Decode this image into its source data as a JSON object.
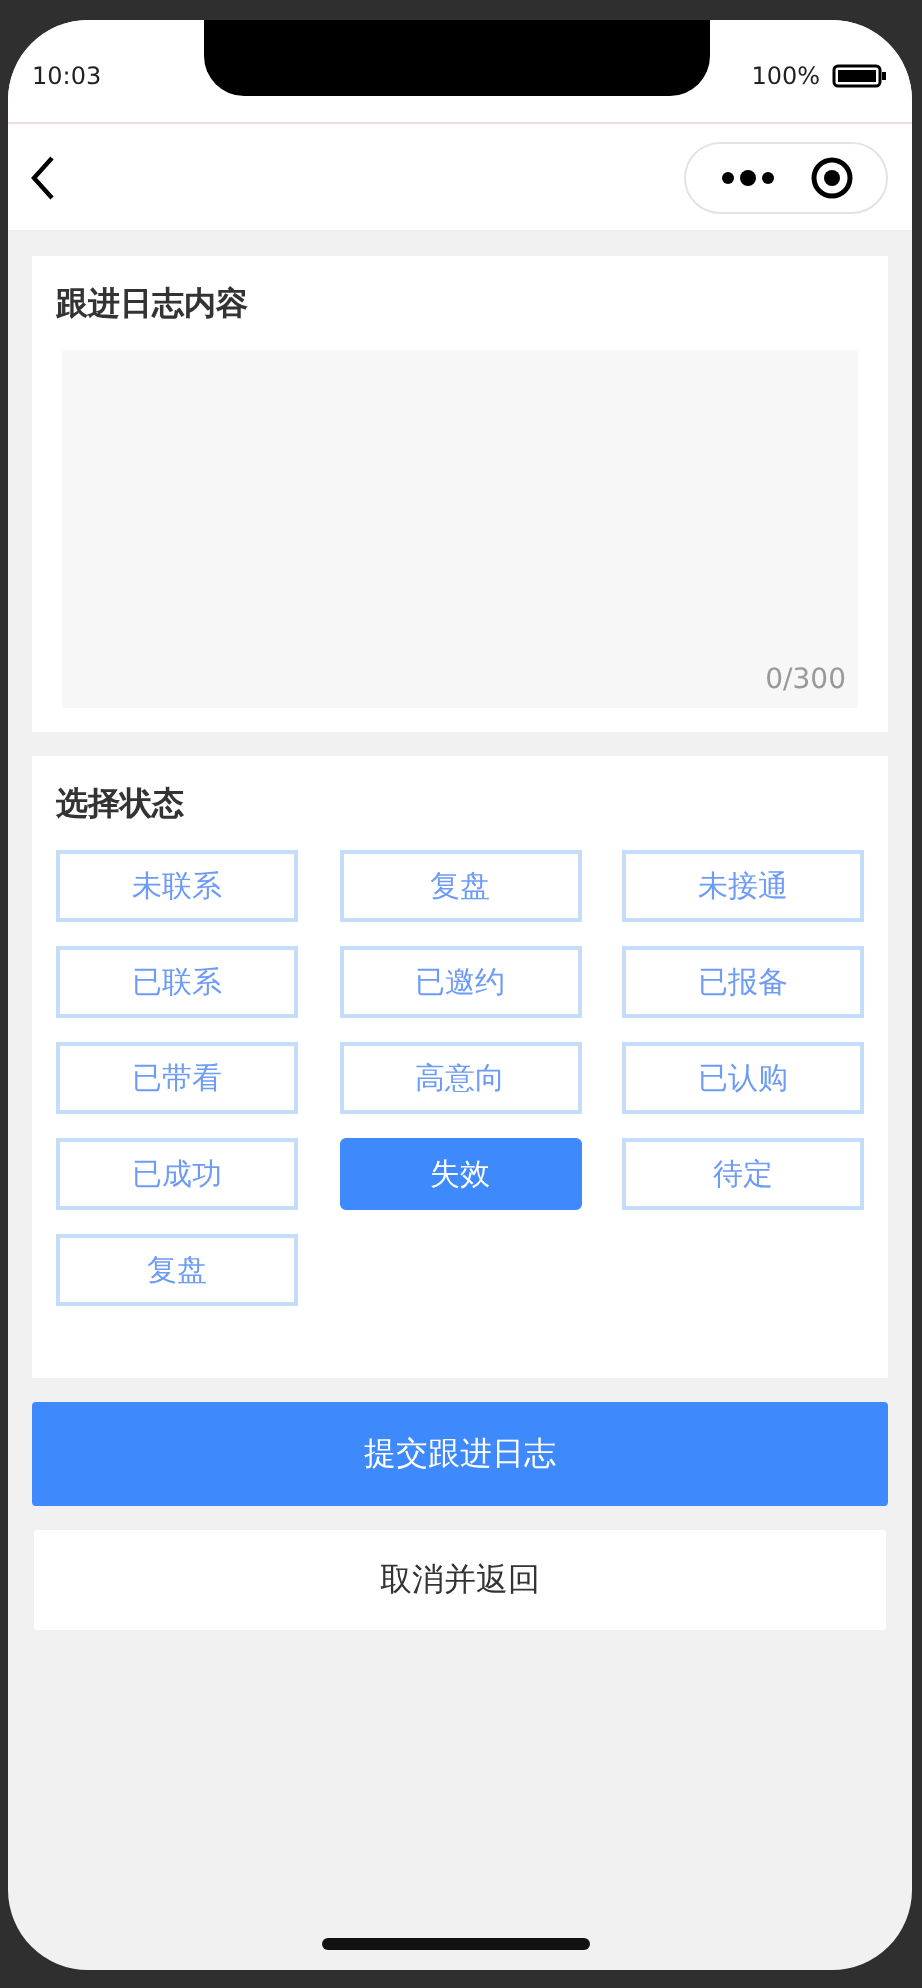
{
  "status_bar": {
    "time": "10:03",
    "battery_percent": "100%"
  },
  "log_section": {
    "title": "跟进日志内容",
    "counter": "0/300"
  },
  "status_section": {
    "title": "选择状态",
    "options": [
      {
        "label": "未联系",
        "selected": false
      },
      {
        "label": "复盘",
        "selected": false
      },
      {
        "label": "未接通",
        "selected": false
      },
      {
        "label": "已联系",
        "selected": false
      },
      {
        "label": "已邀约",
        "selected": false
      },
      {
        "label": "已报备",
        "selected": false
      },
      {
        "label": "已带看",
        "selected": false
      },
      {
        "label": "高意向",
        "selected": false
      },
      {
        "label": "已认购",
        "selected": false
      },
      {
        "label": "已成功",
        "selected": false
      },
      {
        "label": "失效",
        "selected": true
      },
      {
        "label": "待定",
        "selected": false
      },
      {
        "label": "复盘",
        "selected": false
      }
    ]
  },
  "buttons": [
    {
      "kind": "primary",
      "label": "提交跟进日志"
    },
    {
      "kind": "secondary",
      "label": "取消并返回"
    }
  ]
}
